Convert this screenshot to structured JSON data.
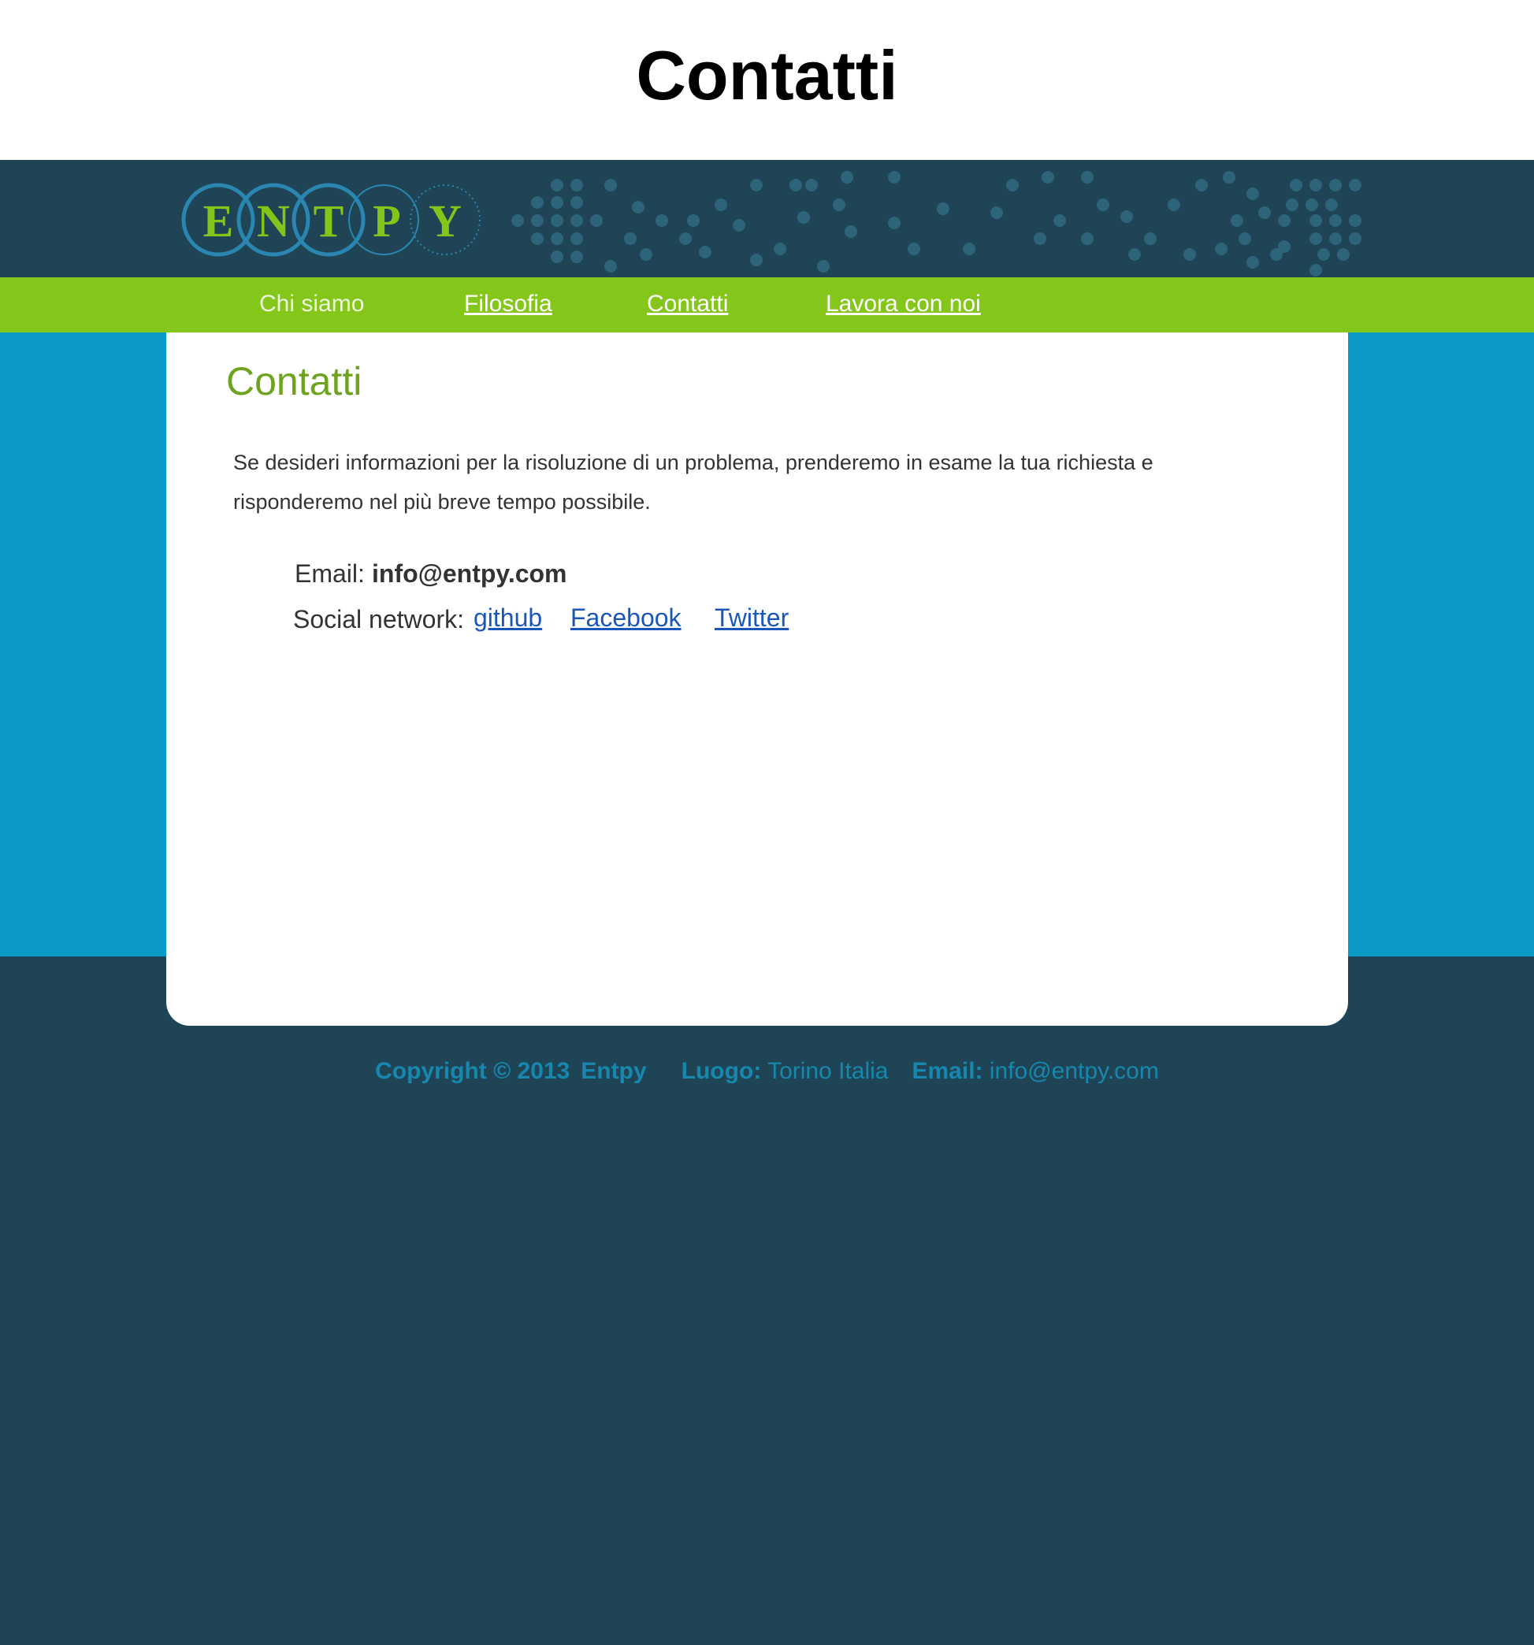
{
  "page": {
    "heading": "Contatti"
  },
  "logo": {
    "letters": [
      "E",
      "N",
      "T",
      "P",
      "Y"
    ]
  },
  "nav": {
    "items": [
      {
        "label": "Chi siamo",
        "current": true
      },
      {
        "label": "Filosofia",
        "current": false
      },
      {
        "label": "Contatti",
        "current": false
      },
      {
        "label": "Lavora con noi",
        "current": false
      }
    ]
  },
  "content": {
    "title": "Contatti",
    "intro": "Se desideri informazioni per la risoluzione di un problema, prenderemo in esame la tua richiesta e risponderemo nel più breve tempo possibile.",
    "email_label": "Email:",
    "email_value": "info@entpy.com",
    "social_label": "Social network:",
    "social_links": [
      "github",
      "Facebook",
      "Twitter"
    ]
  },
  "footer": {
    "copyright": "Copyright © 2013",
    "brand": "Entpy",
    "location_label": "Luogo:",
    "location_value": "Torino Italia",
    "email_label": "Email:",
    "email_value": "info@entpy.com"
  },
  "colors": {
    "dark_teal": "#1f4455",
    "nav_green": "#84c61a",
    "band_blue": "#0b9bc6",
    "title_green": "#6ea31f",
    "link_blue": "#1a57b8",
    "footer_text": "#1787ad"
  }
}
